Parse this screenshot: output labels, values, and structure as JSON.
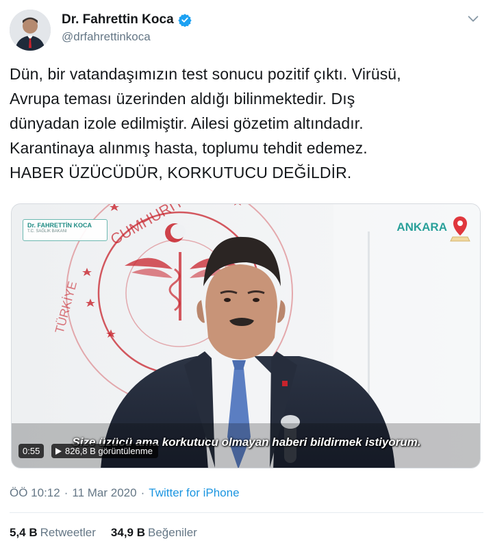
{
  "author": {
    "display_name": "Dr. Fahrettin Koca",
    "handle": "@drfahrettinkoca",
    "verified_icon": "verified-badge-icon",
    "menu_icon": "chevron-down-icon"
  },
  "tweet": {
    "lines": [
      "Dün, bir vatandaşımızın test sonucu pozitif çıktı. Virüsü,",
      "Avrupa teması üzerinden aldığı bilinmektedir. Dış",
      "dünyadan izole edilmiştir. Ailesi gözetim altındadır.",
      "Karantinaya alınmış hasta, toplumu tehdit edemez.",
      "HABER ÜZÜCÜDÜR, KORKUTUCU DEĞİLDİR."
    ]
  },
  "media": {
    "lower_third_name": "Dr. FAHRETTİN KOCA",
    "lower_third_title": "T.C. SAĞLIK BAKANI",
    "location": "ANKARA",
    "subtitle": "Size üzücü ama korkutucu olmayan haberi bildirmek istiyorum.",
    "duration": "0:55",
    "views": "826,8 B görüntülenme"
  },
  "meta": {
    "time": "ÖÖ 10:12",
    "separator": "·",
    "date": "11 Mar 2020",
    "source": "Twitter for iPhone"
  },
  "stats": {
    "retweets_count": "5,4 B",
    "retweets_label": "Retweetler",
    "likes_count": "34,9 B",
    "likes_label": "Beğeniler"
  },
  "colors": {
    "link": "#1b95e0",
    "muted": "#657786",
    "text": "#14171a",
    "accent_teal": "#29a09a",
    "logo_red": "#c8232c"
  }
}
